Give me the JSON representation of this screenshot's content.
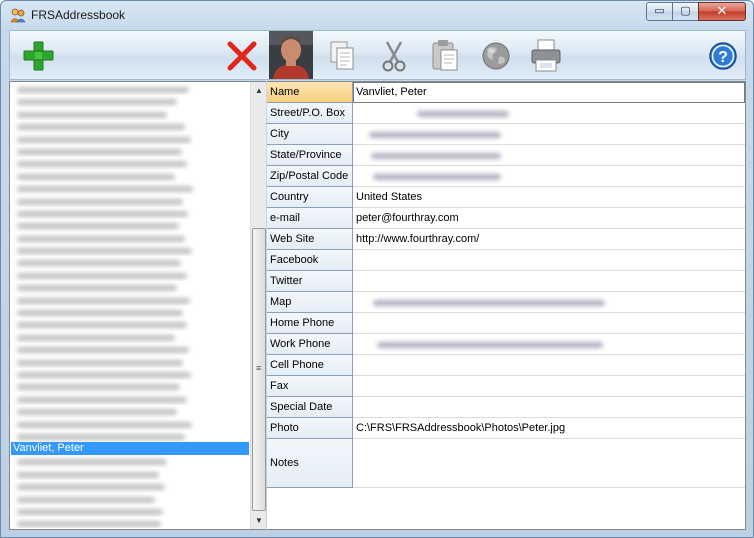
{
  "window": {
    "title": "FRSAddressbook"
  },
  "title_buttons": {
    "minimize": "▭",
    "maximize": "▢",
    "close": "✕"
  },
  "toolbar": {
    "buttons": [
      {
        "name": "add-contact-button",
        "icon": "plus-icon"
      },
      {
        "name": "delete-contact-button",
        "icon": "red-x-icon"
      },
      {
        "name": "contact-photo",
        "icon": "photo-thumbnail"
      },
      {
        "name": "copy-button",
        "icon": "copy-icon"
      },
      {
        "name": "cut-button",
        "icon": "scissors-icon"
      },
      {
        "name": "paste-button",
        "icon": "clipboard-icon"
      },
      {
        "name": "web-button",
        "icon": "globe-icon"
      },
      {
        "name": "print-button",
        "icon": "printer-icon"
      },
      {
        "name": "help-button",
        "icon": "help-icon",
        "label": "?"
      }
    ],
    "colors": {
      "add": "#2fa52f",
      "delete": "#e0261b",
      "help": "#2f7bd6"
    }
  },
  "contact_list": {
    "selected": "Vanvliet, Peter",
    "selected_color": "#3399ff"
  },
  "details": {
    "fields": [
      {
        "label": "Name",
        "value": "Vanvliet, Peter",
        "selected": true
      },
      {
        "label": "Street/P.O. Box",
        "value": ""
      },
      {
        "label": "City",
        "value": ""
      },
      {
        "label": "State/Province",
        "value": ""
      },
      {
        "label": "Zip/Postal Code",
        "value": ""
      },
      {
        "label": "Country",
        "value": "United States"
      },
      {
        "label": "e-mail",
        "value": "peter@fourthray.com"
      },
      {
        "label": "Web Site",
        "value": "http://www.fourthray.com/"
      },
      {
        "label": "Facebook",
        "value": ""
      },
      {
        "label": "Twitter",
        "value": ""
      },
      {
        "label": "Map",
        "value": ""
      },
      {
        "label": "Home Phone",
        "value": ""
      },
      {
        "label": "Work Phone",
        "value": ""
      },
      {
        "label": "Cell Phone",
        "value": ""
      },
      {
        "label": "Fax",
        "value": ""
      },
      {
        "label": "Special Date",
        "value": ""
      },
      {
        "label": "Photo",
        "value": "C:\\FRS\\FRSAddressbook\\Photos\\Peter.jpg"
      },
      {
        "label": "Notes",
        "value": ""
      }
    ]
  }
}
